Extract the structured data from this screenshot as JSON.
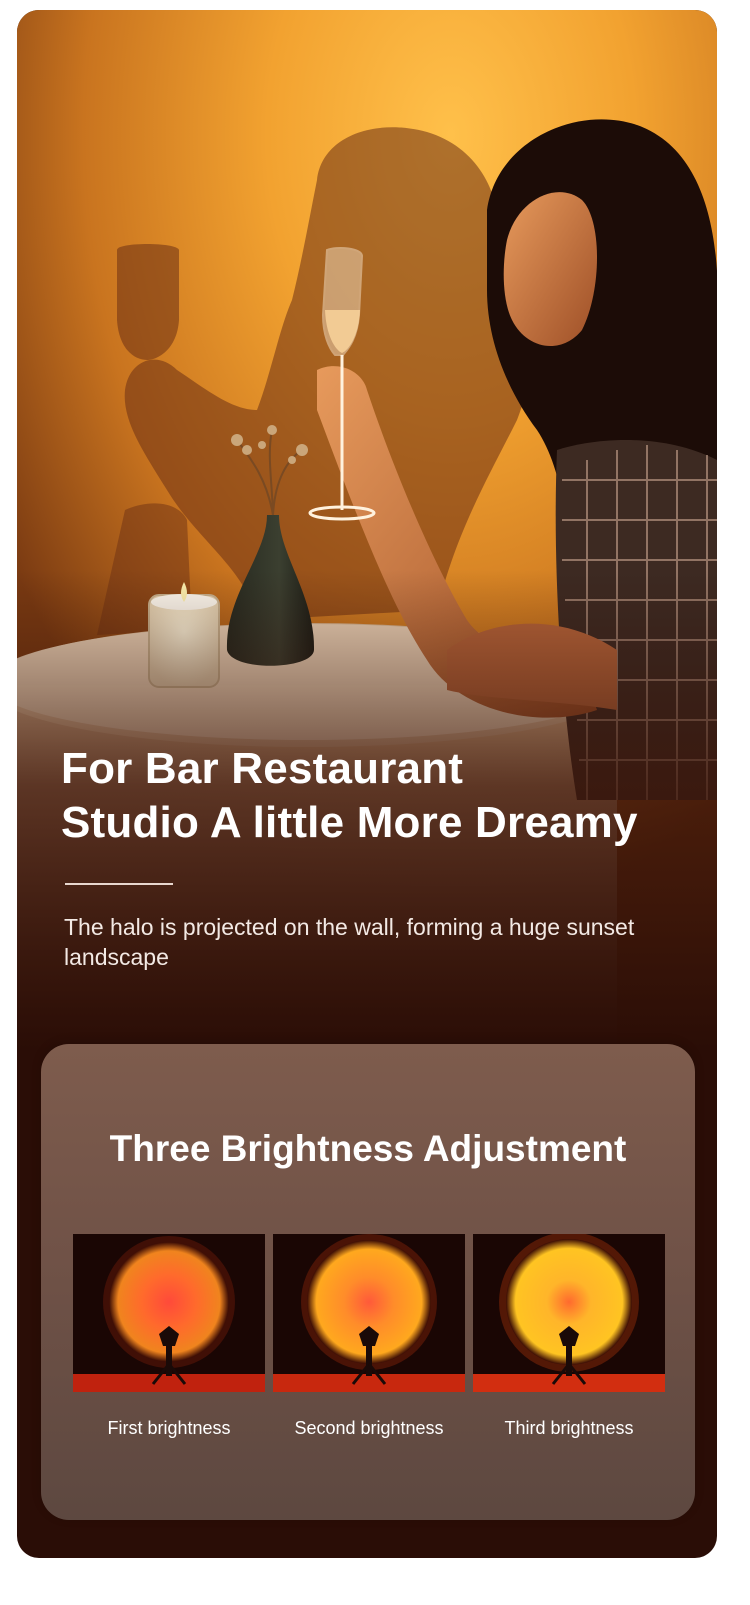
{
  "hero": {
    "title": "For Bar Restaurant\nStudio  A little More Dreamy",
    "subtitle": "The halo is projected on the wall, forming a huge sunset landscape"
  },
  "brightness": {
    "title": "Three Brightness Adjustment",
    "levels": [
      {
        "label": "First brightness",
        "level": 1
      },
      {
        "label": "Second brightness",
        "level": 2
      },
      {
        "label": "Third brightness",
        "level": 3
      }
    ]
  },
  "colors": {
    "wall_glow": "#f5a52f",
    "panel": "#785749",
    "text": "#ffffff"
  }
}
